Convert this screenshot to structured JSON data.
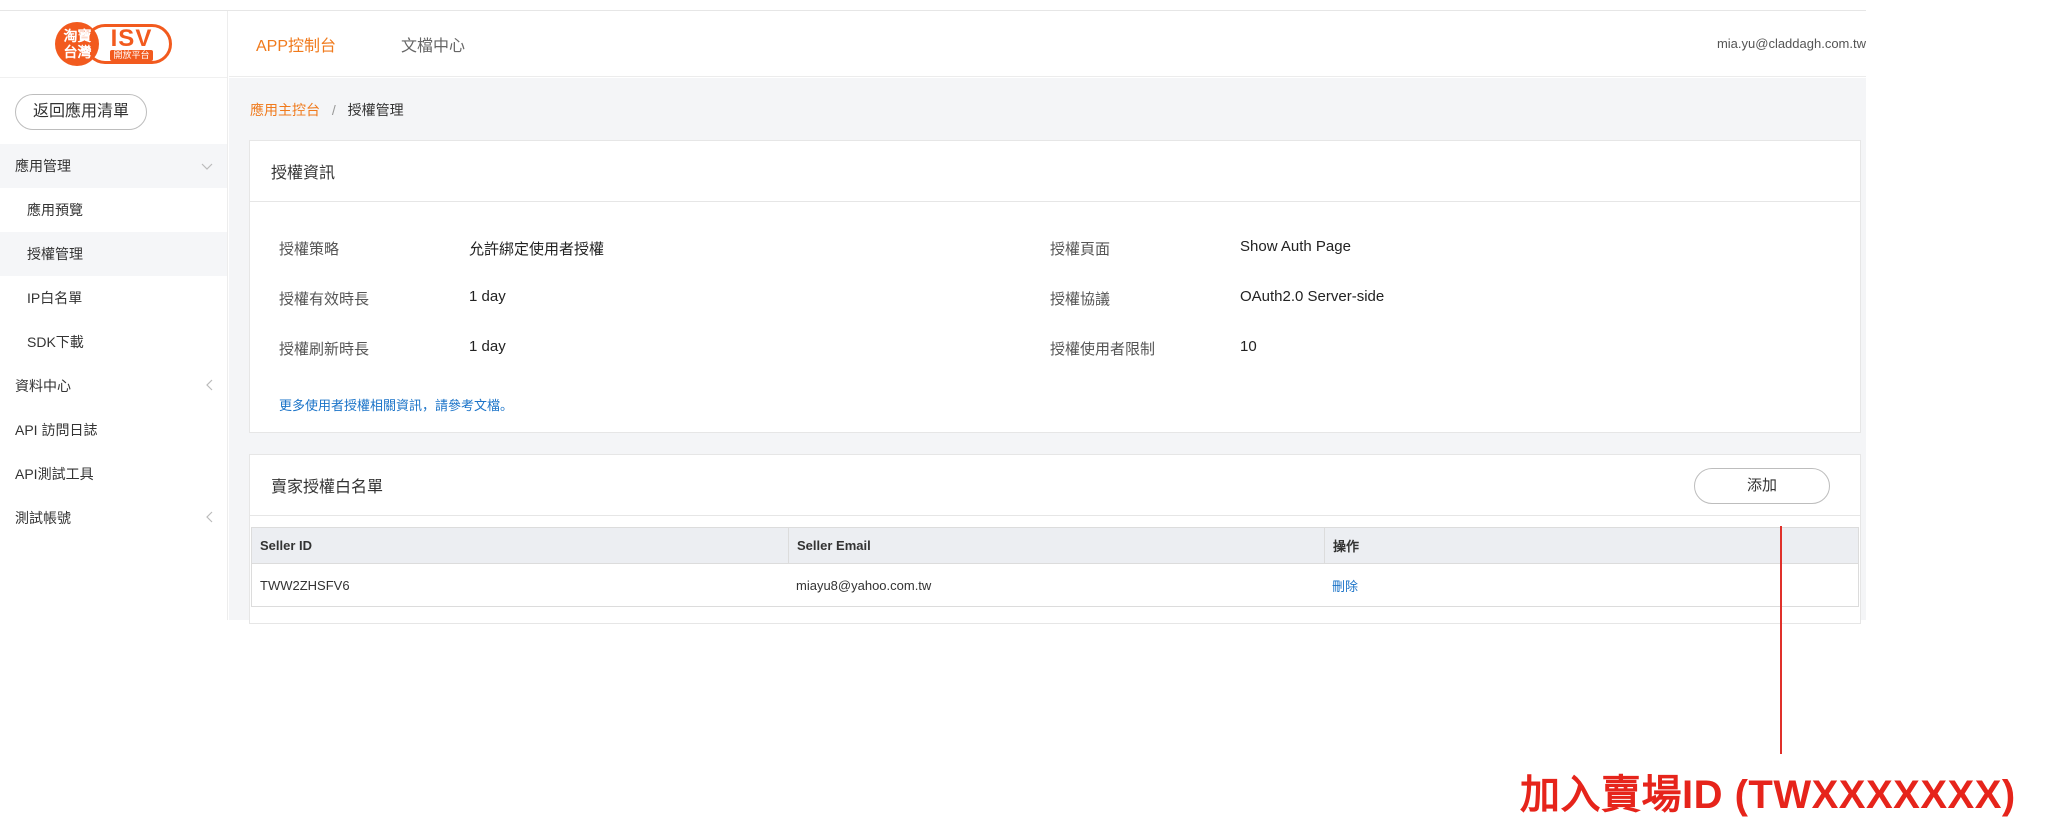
{
  "logo": {
    "circle_top": "淘寶",
    "circle_bottom": "台灣",
    "brand": "ISV",
    "sub": "開放平台"
  },
  "sidebar": {
    "back_button": "返回應用清單",
    "items": [
      {
        "label": "應用管理",
        "type": "group",
        "chevron": "chevron-down"
      },
      {
        "label": "應用預覽",
        "type": "sub"
      },
      {
        "label": "授權管理",
        "type": "sub",
        "active": true
      },
      {
        "label": "IP白名單",
        "type": "sub"
      },
      {
        "label": "SDK下載",
        "type": "sub"
      },
      {
        "label": "資料中心",
        "type": "top",
        "chevron": "chevron-left"
      },
      {
        "label": "API 訪問日誌",
        "type": "top"
      },
      {
        "label": "API測試工具",
        "type": "top"
      },
      {
        "label": "測試帳號",
        "type": "top",
        "chevron": "chevron-left"
      }
    ]
  },
  "header": {
    "tabs": [
      {
        "label": "APP控制台",
        "active": true
      },
      {
        "label": "文檔中心",
        "active": false
      }
    ],
    "user_email": "mia.yu@claddagh.com.tw"
  },
  "breadcrumb": {
    "root": "應用主控台",
    "separator": "/",
    "current": "授權管理"
  },
  "auth_info": {
    "title": "授權資訊",
    "left": [
      {
        "label": "授權策略",
        "value": "允許綁定使用者授權"
      },
      {
        "label": "授權有效時長",
        "value": "1 day"
      },
      {
        "label": "授權刷新時長",
        "value": "1 day"
      }
    ],
    "right": [
      {
        "label": "授權頁面",
        "value": "Show Auth Page"
      },
      {
        "label": "授權協議",
        "value": "OAuth2.0 Server-side"
      },
      {
        "label": "授權使用者限制",
        "value": "10"
      }
    ],
    "more_link": "更多使用者授權相關資訊，請參考文檔。"
  },
  "whitelist": {
    "title": "賣家授權白名單",
    "add_button": "添加",
    "columns": [
      "Seller ID",
      "Seller Email",
      "操作"
    ],
    "rows": [
      {
        "seller_id": "TWW2ZHSFV6",
        "seller_email": "miayu8@yahoo.com.tw",
        "action": "刪除"
      }
    ]
  },
  "annotation": {
    "text": "加入賣場ID (TWXXXXXXX)",
    "color": "#e6241b"
  },
  "colors": {
    "accent": "#f07a1c",
    "link": "#1a73c8",
    "logo": "#f25a1e"
  }
}
